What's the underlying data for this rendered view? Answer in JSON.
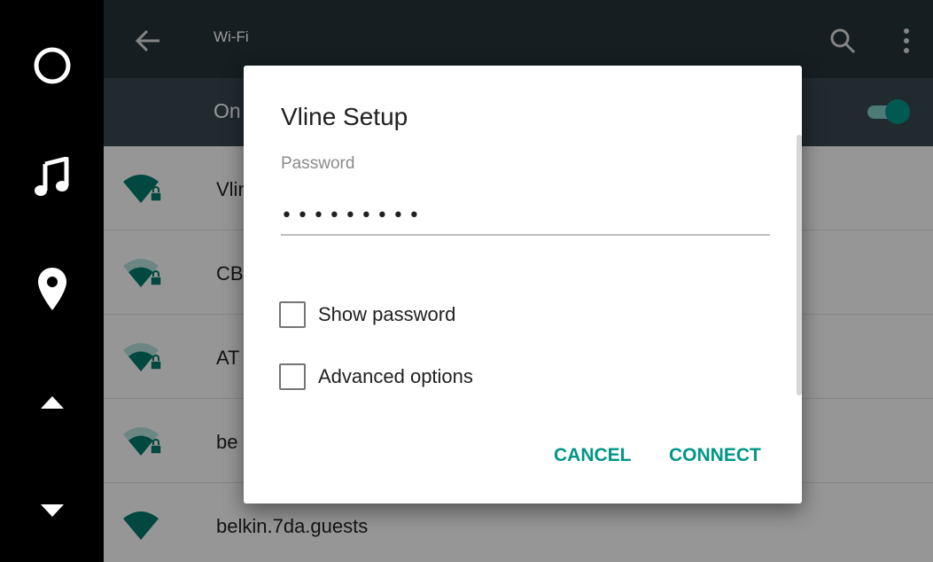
{
  "colors": {
    "accent": "#009688",
    "toolbar": "#263238",
    "switchbar": "#37474f",
    "rail": "#000000"
  },
  "rail": {
    "items": [
      {
        "name": "home",
        "icon": "circle-icon"
      },
      {
        "name": "music",
        "icon": "music-note-icon"
      },
      {
        "name": "navigation",
        "icon": "location-pin-icon"
      },
      {
        "name": "scroll-up",
        "icon": "triangle-up-icon"
      },
      {
        "name": "scroll-down",
        "icon": "triangle-down-icon"
      }
    ]
  },
  "toolbar": {
    "title": "Wi-Fi",
    "back_icon": "arrow-left-icon",
    "search_icon": "search-icon",
    "menu_icon": "more-vert-icon"
  },
  "switchbar": {
    "label": "On",
    "state": "on"
  },
  "networks": [
    {
      "ssid": "Vline",
      "secured": true,
      "signal": 4
    },
    {
      "ssid": "CB",
      "secured": true,
      "signal": 3
    },
    {
      "ssid": "AT",
      "secured": true,
      "signal": 3
    },
    {
      "ssid": "be",
      "secured": true,
      "signal": 3
    },
    {
      "ssid": "belkin.7da.guests",
      "secured": false,
      "signal": 4
    }
  ],
  "dialog": {
    "title": "Vline Setup",
    "password_label": "Password",
    "password_value": "vline2015",
    "show_password_label": "Show password",
    "show_password_checked": false,
    "advanced_label": "Advanced options",
    "advanced_checked": false,
    "cancel_label": "CANCEL",
    "connect_label": "CONNECT"
  }
}
